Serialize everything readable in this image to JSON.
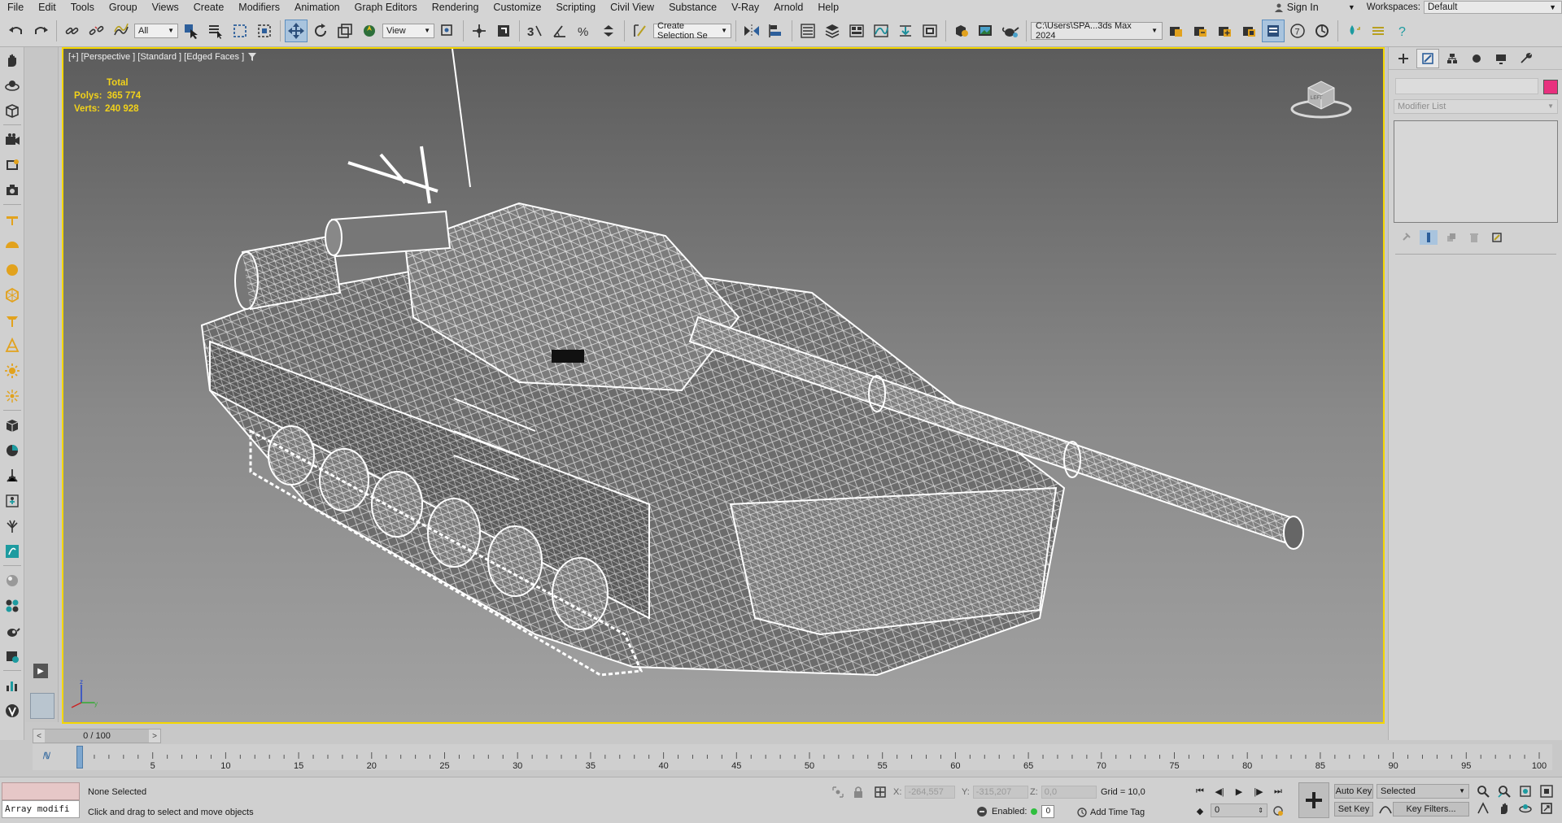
{
  "menu": {
    "items": [
      "File",
      "Edit",
      "Tools",
      "Group",
      "Views",
      "Create",
      "Modifiers",
      "Animation",
      "Graph Editors",
      "Rendering",
      "Customize",
      "Scripting",
      "Civil View",
      "Substance",
      "V-Ray",
      "Arnold",
      "Help"
    ],
    "sign_in": "Sign In",
    "workspaces_label": "Workspaces:",
    "workspace_value": "Default"
  },
  "toolbar": {
    "filter_value": "All",
    "ref_coord_value": "View",
    "selection_set_placeholder": "Create Selection Se",
    "project_path": "C:\\Users\\SPA...3ds Max 2024"
  },
  "viewport": {
    "label": "[+] [Perspective ] [Standard ] [Edged Faces ]",
    "stats_header": "Total",
    "polys_label": "Polys:",
    "polys_value": "365 774",
    "verts_label": "Verts:",
    "verts_value": "240 928",
    "viewcube_label": "LEFT"
  },
  "command_panel": {
    "modifier_list_placeholder": "Modifier List",
    "object_color": "#e8307e"
  },
  "timeline": {
    "current": "0 / 100",
    "ticks": [
      "0",
      "5",
      "10",
      "15",
      "20",
      "25",
      "30",
      "35",
      "40",
      "45",
      "50",
      "55",
      "60",
      "65",
      "70",
      "75",
      "80",
      "85",
      "90",
      "95",
      "100"
    ]
  },
  "status": {
    "maxscript_text": "Array modifi",
    "selection_status": "None Selected",
    "prompt": "Click and drag to select and move objects",
    "x_label": "X:",
    "x_value": "-264,557",
    "y_label": "Y:",
    "y_value": "-315,207",
    "z_label": "Z:",
    "z_value": "0,0",
    "grid": "Grid = 10,0",
    "enabled_label": "Enabled:",
    "enabled_count": "0",
    "add_time_tag": "Add Time Tag",
    "frame_value": "0",
    "auto_key": "Auto Key",
    "set_key": "Set Key",
    "selected_value": "Selected",
    "key_filters": "Key Filters..."
  },
  "colors": {
    "viewport_border": "#f5d700",
    "stats_text": "#f2d21a",
    "active_button": "#a9c4de"
  }
}
